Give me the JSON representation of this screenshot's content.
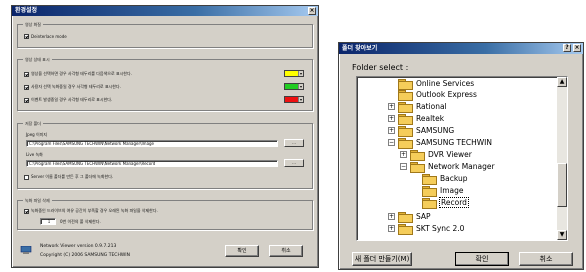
{
  "left_dialog": {
    "title": "환경설정",
    "close_glyph": "×",
    "display": {
      "legend": "영상 화질",
      "deinterlace_label": "Deinterlace mode"
    },
    "status_display": {
      "legend": "영상 상태 표시",
      "items": [
        {
          "label": "영상을 선택하면 경우 사각형 테두리를 다음색으로 표시한다.",
          "color": "#ffff00"
        },
        {
          "label": "사용자 선택 녹화중일 경우 사각형 테두리로 표시한다.",
          "color": "#22cc22"
        },
        {
          "label": "이벤트 발생중일 경우 사각형 테두리로 표시한다.",
          "color": "#ee1111"
        }
      ],
      "drop_glyph": "▾"
    },
    "storage": {
      "legend": "저장 폴더",
      "jpeg_label": "Jpeg 이미지",
      "jpeg_path": "C:\\Program Files\\SAMSUNG TECHWIN\\Network Manager\\Image",
      "live_label": "Live 녹화",
      "live_path": "C:\\Program Files\\SAMSUNG TECHWIN\\Network Manager\\Record",
      "browse_label": "...",
      "server_folder_label": "Server 이름 폴더를 만든 후 그 폴더에 녹화한다."
    },
    "recording": {
      "legend": "녹화 파일 삭제",
      "auto_delete_label": "녹화중인 드라이브의 여유 공간이 부족할 경우 오래된 녹화 파일을 삭제한다.",
      "days_value": "1",
      "days_suffix": "0번 이전의 폴 삭제한다."
    },
    "footer": {
      "version": "Network Viewer version 0.9.7.213",
      "copyright": "Copyright (C) 2006 SAMSUNG TECHWIN",
      "ok_label": "확인",
      "cancel_label": "취소"
    }
  },
  "right_dialog": {
    "title": "폴더 찾아보기",
    "help_glyph": "?",
    "close_glyph": "×",
    "prompt": "Folder select :",
    "tree_items": [
      {
        "label": "Online Services",
        "expander": ""
      },
      {
        "label": "Outlook Express",
        "expander": ""
      },
      {
        "label": "Rational",
        "expander": "+"
      },
      {
        "label": "Realtek",
        "expander": "+"
      },
      {
        "label": "SAMSUNG",
        "expander": "+"
      },
      {
        "label": "SAMSUNG TECHWIN",
        "expander": "−"
      },
      {
        "label": "DVR Viewer",
        "expander": "+"
      },
      {
        "label": "Network Manager",
        "expander": "−"
      },
      {
        "label": "Backup",
        "expander": ""
      },
      {
        "label": "Image",
        "expander": ""
      },
      {
        "label": "Record",
        "expander": ""
      },
      {
        "label": "SAP",
        "expander": "+"
      },
      {
        "label": "SKT Sync 2.0",
        "expander": "+"
      }
    ],
    "scroll_up": "▲",
    "scroll_down": "▼",
    "new_folder_label": "새 폴더 만들기(M)",
    "ok_label": "확인",
    "cancel_label": "취소"
  }
}
